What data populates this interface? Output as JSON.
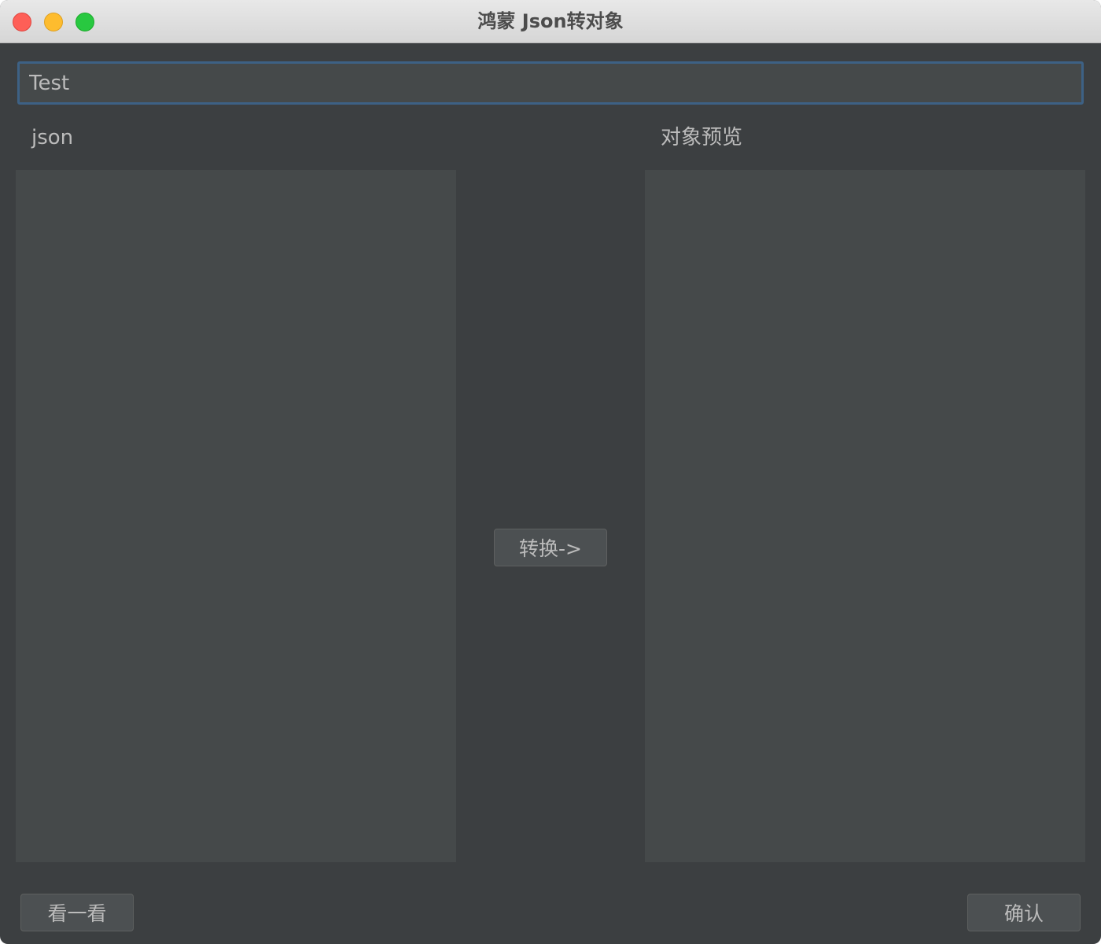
{
  "window": {
    "title": "鸿蒙 Json转对象"
  },
  "form": {
    "class_name_value": "Test",
    "json_label": "json",
    "preview_label": "对象预览",
    "json_text": "",
    "preview_text": ""
  },
  "buttons": {
    "convert_label": "转换->",
    "look_label": "看一看",
    "confirm_label": "确认"
  },
  "colors": {
    "window_bg": "#3c3f41",
    "panel_bg": "#45494a",
    "focus_border": "#3d6185",
    "text": "#bbbbbb"
  }
}
